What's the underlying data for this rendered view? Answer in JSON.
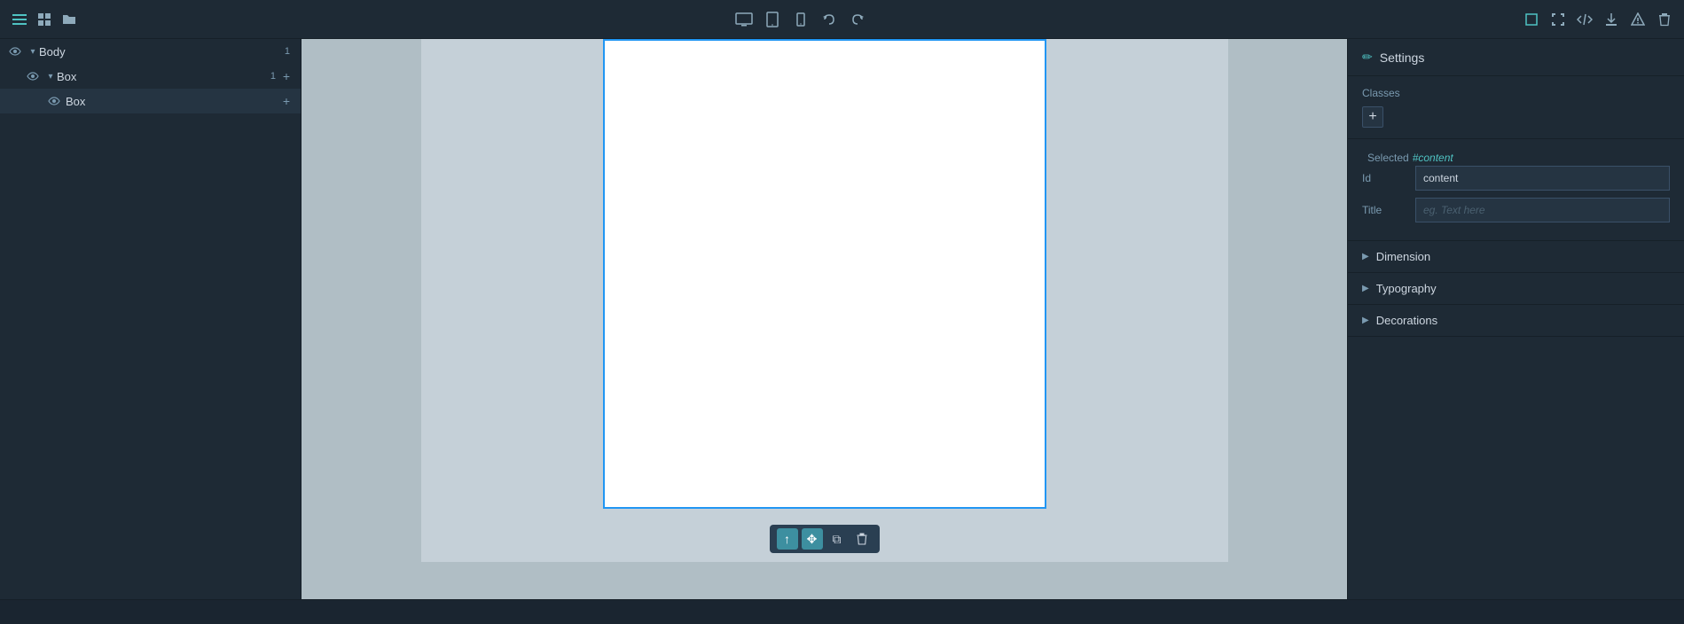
{
  "toolbar": {
    "left_icons": [
      "menu-icon",
      "grid-icon",
      "folder-icon"
    ],
    "center_icons": [
      "desktop-icon",
      "tablet-icon",
      "mobile-icon"
    ],
    "undo_label": "↺",
    "redo_label": "↻",
    "right_icons": [
      "box-icon",
      "fullscreen-icon",
      "code-icon",
      "download-icon",
      "warning-icon",
      "delete-icon"
    ]
  },
  "layers": {
    "items": [
      {
        "label": "Body",
        "count": "1",
        "indent": 0,
        "has_arrow": true,
        "has_add": false
      },
      {
        "label": "Box",
        "count": "1",
        "indent": 1,
        "has_arrow": true,
        "has_add": true
      },
      {
        "label": "Box",
        "count": "",
        "indent": 2,
        "has_arrow": false,
        "has_add": true
      }
    ]
  },
  "canvas": {
    "float_toolbar": {
      "up_label": "↑",
      "move_label": "✥",
      "copy_label": "⧉",
      "delete_label": "🗑"
    }
  },
  "settings": {
    "title": "Settings",
    "classes_label": "Classes",
    "classes_add_label": "+",
    "selected_label": "Selected",
    "selected_id": "#content",
    "id_label": "Id",
    "id_value": "content",
    "title_label": "Title",
    "title_placeholder": "eg. Text here",
    "accordion": [
      {
        "label": "Dimension"
      },
      {
        "label": "Typography"
      },
      {
        "label": "Decorations"
      }
    ]
  },
  "colors": {
    "accent": "#4fc3c3",
    "border_selected": "#2196f3",
    "bg_panel": "#1e2a35",
    "bg_canvas": "#c5d0d8"
  }
}
